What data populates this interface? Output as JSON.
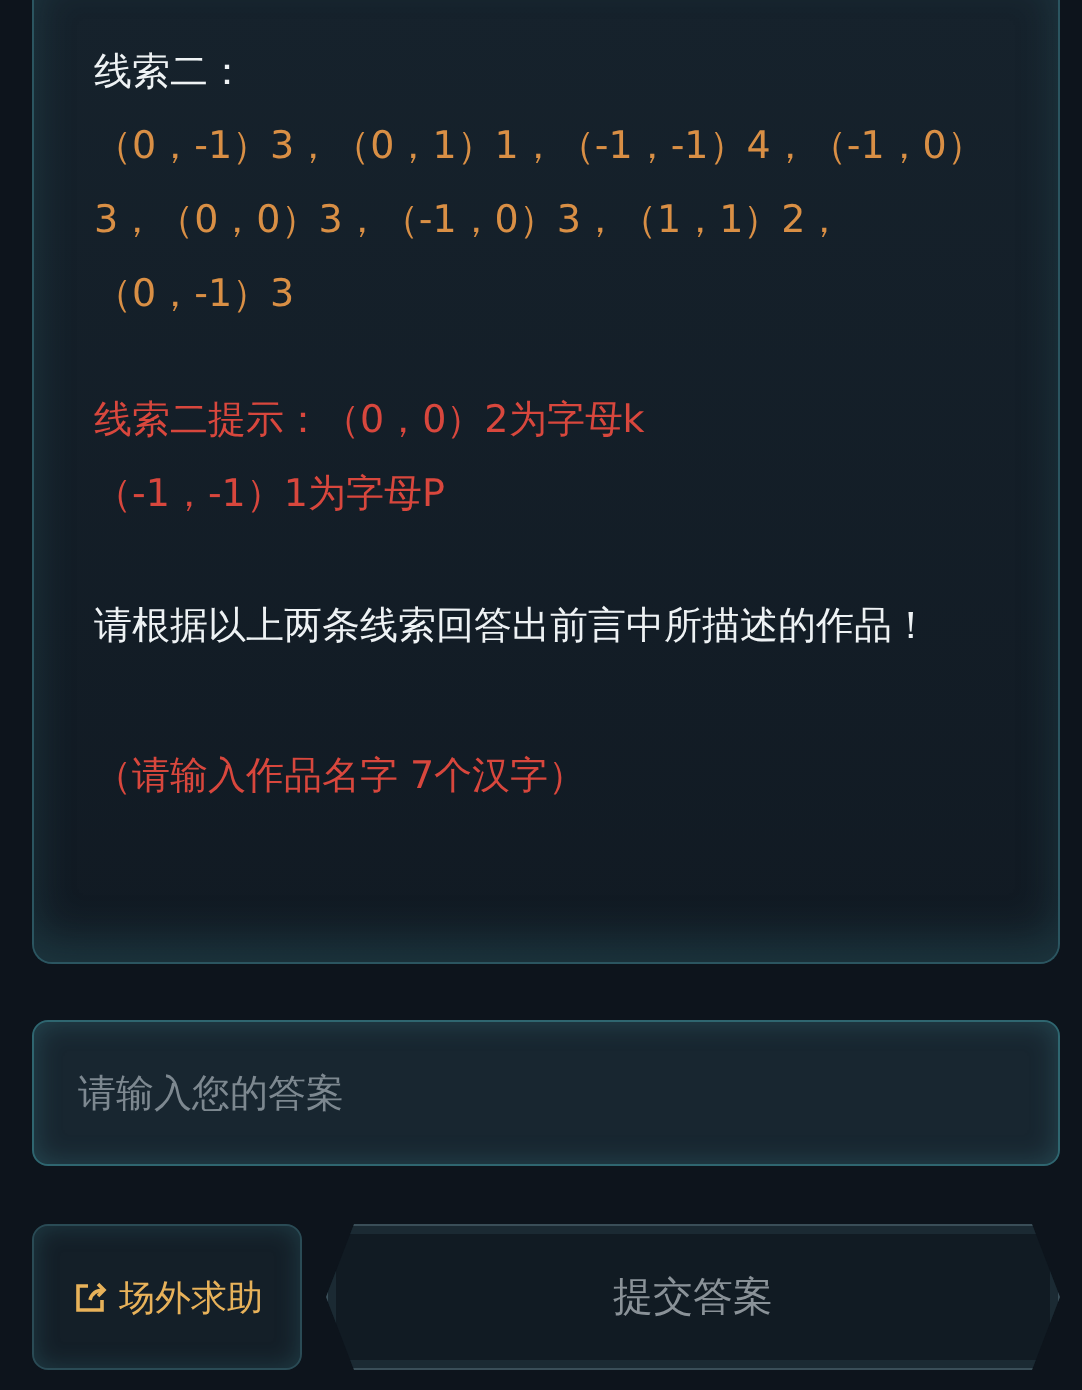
{
  "card": {
    "clue_title": "线索二：",
    "clue_text": "（0，-1）3，（0，1）1，（-1，-1）4，（-1，0）3，（0，0）3，（-1，0）3，（1，1）2，（0，-1）3",
    "hint_lines": [
      "线索二提示：（0，0）2为字母k",
      "（-1，-1）1为字母P"
    ],
    "question": "请根据以上两条线索回答出前言中所描述的作品！",
    "note": "（请输入作品名字 7个汉字）"
  },
  "answer_field": {
    "placeholder": "请输入您的答案"
  },
  "buttons": {
    "help": "场外求助",
    "submit": "提交答案"
  }
}
